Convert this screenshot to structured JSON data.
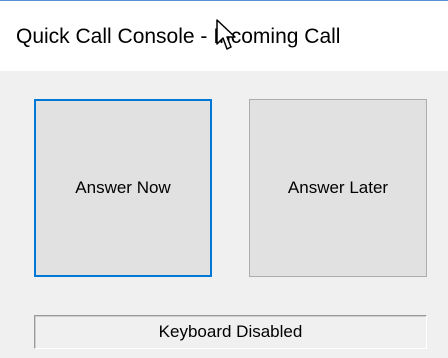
{
  "window": {
    "title": "Quick Call Console - Incoming Call"
  },
  "buttons": {
    "answer_now": "Answer Now",
    "answer_later": "Answer Later"
  },
  "status": {
    "text": "Keyboard Disabled"
  },
  "icons": {
    "cursor": "mouse-pointer-icon"
  },
  "colors": {
    "focus_border": "#0078d7",
    "title_border": "#5b8fd3",
    "button_face": "#e1e1e1"
  }
}
